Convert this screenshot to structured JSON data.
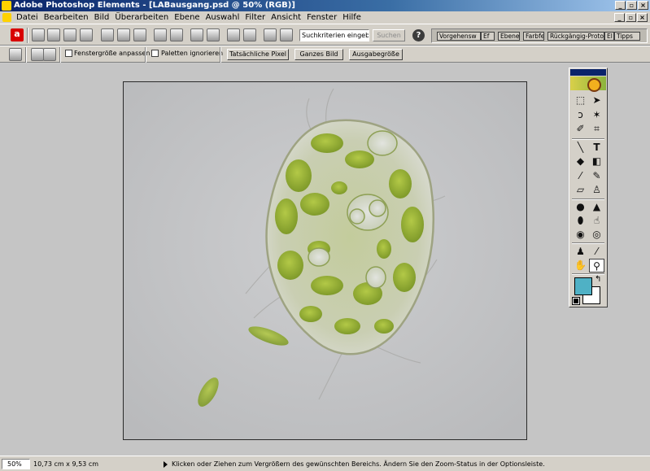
{
  "window": {
    "title": "Adobe Photoshop Elements - [LABausgang.psd @ 50% (RGB)]",
    "buttons": [
      "_",
      "▫",
      "×"
    ]
  },
  "menu": {
    "items": [
      "Datei",
      "Bearbeiten",
      "Bild",
      "Überarbeiten",
      "Ebene",
      "Auswahl",
      "Filter",
      "Ansicht",
      "Fenster",
      "Hilfe"
    ]
  },
  "shortcuts": {
    "search_placeholder": "Suchkriterien eingeben",
    "search_button": "Suchen",
    "help": "?",
    "palette_tabs": [
      "Vorgehensw",
      "Ef",
      "Ebenen",
      "Farbfe",
      "Rückgängig-Protok",
      "El",
      "Tipps"
    ]
  },
  "options": {
    "checkbox_resize": "Fenstergröße anpassen",
    "checkbox_ignore_palettes": "Paletten ignorieren",
    "btn_actual_pixels": "Tatsächliche Pixel",
    "btn_fit_screen": "Ganzes Bild",
    "btn_print_size": "Ausgabegröße"
  },
  "colors": {
    "foreground": "#4fb1c5",
    "background": "#ffffff",
    "titlebar": "#0a246a",
    "chrome": "#d4d0c8"
  },
  "status": {
    "zoom": "50%",
    "doc_size": "10,73 cm x 9,53 cm",
    "message": "Klicken oder Ziehen zum Vergrößern des gewünschten Bereichs. Ändern Sie den Zoom-Status in der Optionsleiste."
  }
}
